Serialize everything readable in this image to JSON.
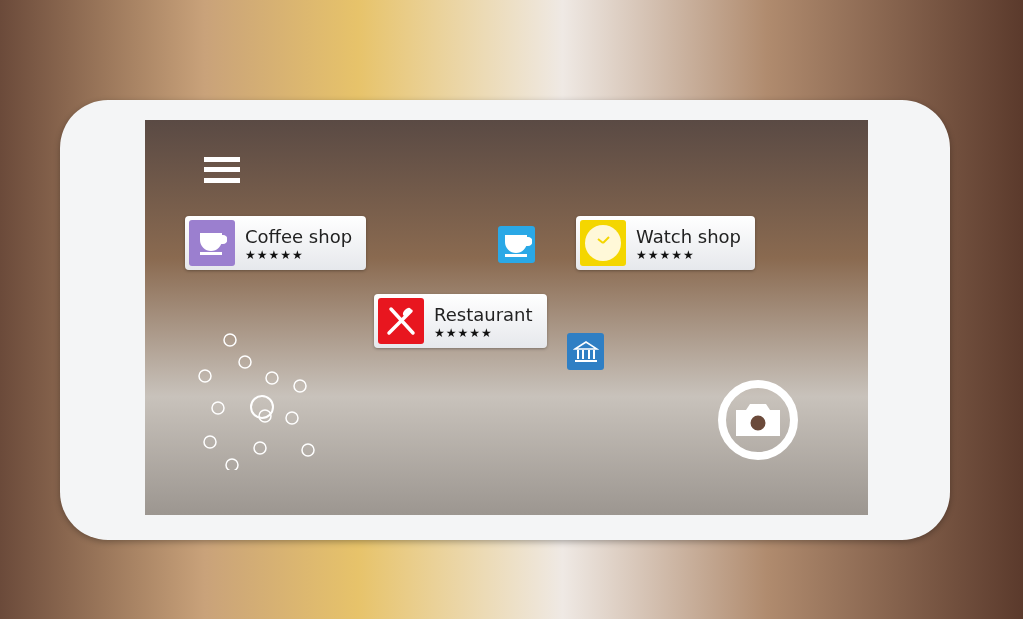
{
  "ar_markers": [
    {
      "kind": "card",
      "label": "Coffee shop",
      "stars": 5,
      "color": "#9b7fcf"
    },
    {
      "kind": "tile",
      "color": "#2aa8e6"
    },
    {
      "kind": "card",
      "label": "Watch shop",
      "stars": 5,
      "color": "#f4d600"
    },
    {
      "kind": "card",
      "label": "Restaurant",
      "stars": 5,
      "color": "#e8161f"
    },
    {
      "kind": "tile",
      "color": "#2f7fc4"
    }
  ]
}
